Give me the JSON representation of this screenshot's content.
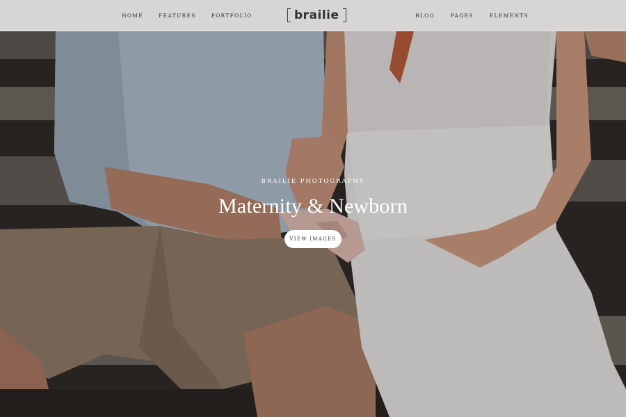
{
  "nav": {
    "left_items": [
      "Home",
      "Features",
      "Portfolio"
    ],
    "right_items": [
      "Blog",
      "Pages",
      "Elements"
    ],
    "logo_text": "brailie"
  },
  "hero": {
    "kicker": "Brailie Photography",
    "title": "Maternity & Newborn",
    "button_label": "View Images"
  },
  "colors": {
    "nav_bg": "#f4f3f3",
    "nav_text": "#2c2c2c",
    "hero_text": "#ffffff",
    "button_bg": "#ffffff"
  }
}
